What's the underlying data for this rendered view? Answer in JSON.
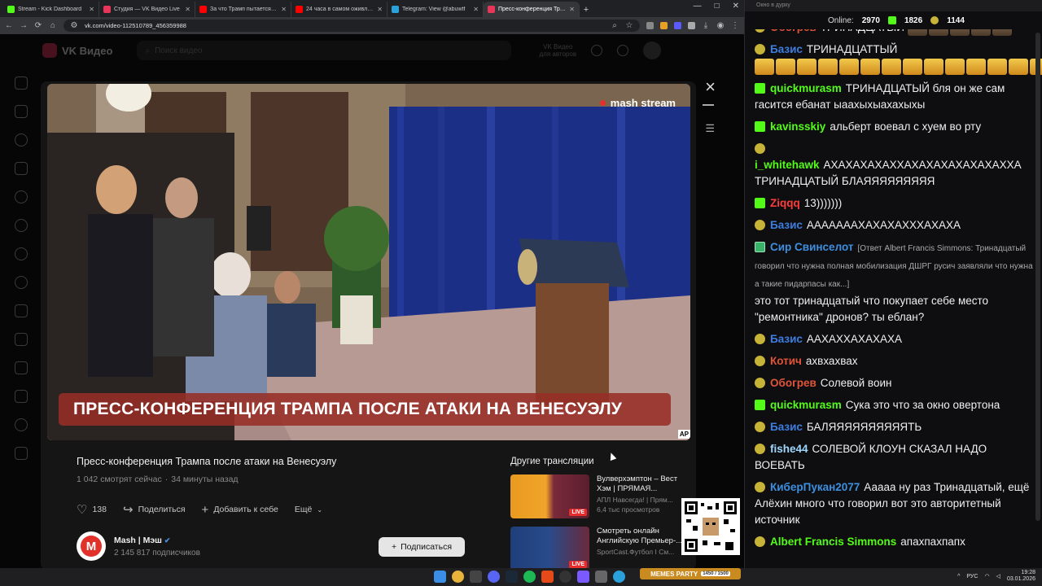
{
  "browser": {
    "tabs": [
      {
        "label": "Stream - Kick Dashboard",
        "color": "#53fc18",
        "active": false
      },
      {
        "label": "Студия — VK Видео Live",
        "color": "#e8365b",
        "active": false
      },
      {
        "label": "За что Трамп пытается убить",
        "color": "#ff0000",
        "active": false
      },
      {
        "label": "24 часа в самом оживлённом",
        "color": "#ff0000",
        "active": false
      },
      {
        "label": "Telegram: View @abuwtf",
        "color": "#2aa1da",
        "active": false
      },
      {
        "label": "Пресс-конференция Трам",
        "color": "#e8365b",
        "active": true
      }
    ],
    "new_tab": "+",
    "url": "vk.com/video-112510789_456359988"
  },
  "vk": {
    "logo_text": "VK Видео",
    "search_placeholder": "Поиск видео",
    "authors_line1": "VK Видео",
    "authors_line2": "для авторов"
  },
  "player": {
    "brand": "mash stream",
    "lower_third": "ПРЕСС-КОНФЕРЕНЦИЯ ТРАМПА ПОСЛЕ АТАКИ НА ВЕНЕСУЭЛУ",
    "ap": "AP",
    "close": "×",
    "playlist": "☰"
  },
  "video": {
    "title": "Пресс-конференция Трампа после атаки на Венесуэлу",
    "viewers": "1 042 смотрят сейчас",
    "separator": "·",
    "ago": "34 минуты назад",
    "likes": "138",
    "share": "Поделиться",
    "add": "Добавить к себе",
    "more": "Ещё"
  },
  "channel": {
    "avatar_letter": "M",
    "name": "Mash | Мэш",
    "verified": "✔",
    "subscribers": "2 145 817 подписчиков",
    "subscribe": "Подписаться"
  },
  "others": {
    "title": "Другие трансляции",
    "items": [
      {
        "title": "Вулверхэмптон – Вест Хэм | ПРЯМАЯ...",
        "sub": "АПЛ Навсегда! | Прям...",
        "views": "6,4 тыс просмотров",
        "live": "LIVE"
      },
      {
        "title": "Смотреть онлайн Английскую Премьер-...",
        "sub": "SportCast.Футбол I См...",
        "views": "",
        "live": "LIVE"
      }
    ]
  },
  "chat": {
    "window_title": "Окно в дурку",
    "online_label": "Online:",
    "online": "2970",
    "kick_count": "1826",
    "vk_count": "1144",
    "messages": [
      {
        "badge": "pepe",
        "user": "Обогрев",
        "color": "#e0553a",
        "text": "ТРИНАДЦАТЫЙ",
        "emotes": 5,
        "faces": true
      },
      {
        "badge": "pepe",
        "user": "Базис",
        "color": "#3d7de0",
        "text": "ТРИНАДЦАТТЫЙ",
        "emotes": 18,
        "faces": false
      },
      {
        "badge": "kick",
        "user": "quickmurasm",
        "color": "#53fc18",
        "text": "ТРИНАДЦАТЫЙ бля он же сам гасится ебанат ыаахыхыахахыхы"
      },
      {
        "badge": "kick",
        "user": "kavinsskiy",
        "color": "#53fc18",
        "text": "альберт воевал с хуем во рту"
      },
      {
        "badge": "pepe",
        "user": "i_whitehawk",
        "color": "#53fc18",
        "text": "АХАХАХАХАХХАХАХАХАХАХАХАХХА ТРИНАДЦАТЫЙ БЛАЯЯЯЯЯЯЯЯЯ"
      },
      {
        "badge": "kick",
        "user": "Ziqqq",
        "color": "#ff3c3c",
        "text": "13)))))))"
      },
      {
        "badge": "pepe",
        "user": "Базис",
        "color": "#3d7de0",
        "text": "АААААААХАХАХАХХХАХАХА"
      },
      {
        "badge": "shield",
        "user": "Сир Свинселот",
        "color": "#3d8fe0",
        "reply": "[Ответ Albert Francis Simmons: Тринадцатый говорил что нужна полная мобилизация ДШРГ русич заявляли что нужна а такие пидарпасы как...]",
        "text": "это тот тринадцатый что покупает себе место \"ремонтника\" дронов? ты еблан?"
      },
      {
        "badge": "pepe",
        "user": "Базис",
        "color": "#3d7de0",
        "text": "ААХАХХАХАХАХА"
      },
      {
        "badge": "pepe",
        "user": "Котич",
        "color": "#e0553a",
        "text": "ахвхахвах"
      },
      {
        "badge": "pepe",
        "user": "Обогрев",
        "color": "#e0553a",
        "text": "Солевой воин"
      },
      {
        "badge": "kick",
        "user": "quickmurasm",
        "color": "#53fc18",
        "text": "Сука это что за окно овертона"
      },
      {
        "badge": "pepe",
        "user": "Базис",
        "color": "#3d7de0",
        "text": "БАЛЯЯЯЯЯЯЯЯЯЯТЬ"
      },
      {
        "badge": "pepe",
        "user": "fishe44",
        "color": "#9fd8ff",
        "text": "СОЛЕВОЙ КЛОУН СКАЗАЛ НАДО ВОЕВАТЬ"
      },
      {
        "badge": "pepe",
        "user": "КиберПукан2077",
        "color": "#3d8fe0",
        "text": "Ааааа ну раз Тринадцатый, ещё Алёхин много что говорил вот это авторитетный источник"
      },
      {
        "badge": "pepe",
        "user": "Albert Francis Simmons",
        "color": "#53fc18",
        "text": "апахпахпапх"
      }
    ]
  },
  "taskbar": {
    "lang": "РУС",
    "time": "19:28",
    "date": "03.01.2026",
    "meme_label": "MEMES PARTY",
    "meme_progress": "1450 / 1500"
  }
}
